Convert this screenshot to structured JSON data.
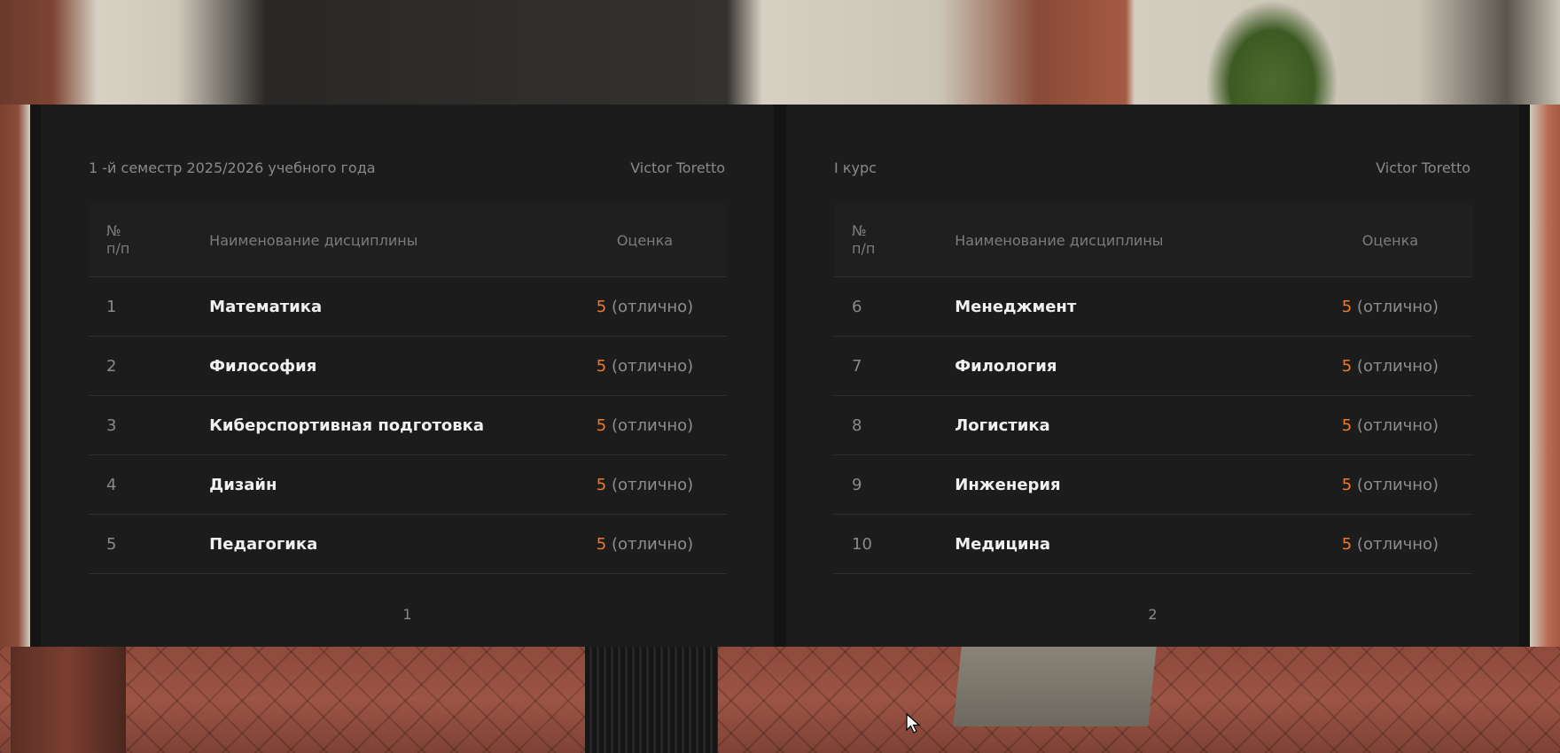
{
  "left_page": {
    "header_left": "1 -й семестр 2025/2026 учебного года",
    "header_right": "Victor Toretto",
    "columns": {
      "num": "№ п/п",
      "name": "Наименование дисциплины",
      "grade": "Оценка"
    },
    "rows": [
      {
        "num": "1",
        "name": "Математика",
        "grade": "5",
        "grade_text": "(отлично)"
      },
      {
        "num": "2",
        "name": "Философия",
        "grade": "5",
        "grade_text": "(отлично)"
      },
      {
        "num": "3",
        "name": "Киберспортивная подготовка",
        "grade": "5",
        "grade_text": "(отлично)"
      },
      {
        "num": "4",
        "name": "Дизайн",
        "grade": "5",
        "grade_text": "(отлично)"
      },
      {
        "num": "5",
        "name": "Педагогика",
        "grade": "5",
        "grade_text": "(отлично)"
      }
    ],
    "page_number": "1"
  },
  "right_page": {
    "header_left": "I курс",
    "header_right": "Victor Toretto",
    "columns": {
      "num": "№ п/п",
      "name": "Наименование дисциплины",
      "grade": "Оценка"
    },
    "rows": [
      {
        "num": "6",
        "name": "Менеджмент",
        "grade": "5",
        "grade_text": "(отлично)"
      },
      {
        "num": "7",
        "name": "Филология",
        "grade": "5",
        "grade_text": "(отлично)"
      },
      {
        "num": "8",
        "name": "Логистика",
        "grade": "5",
        "grade_text": "(отлично)"
      },
      {
        "num": "9",
        "name": "Инженерия",
        "grade": "5",
        "grade_text": "(отлично)"
      },
      {
        "num": "10",
        "name": "Медицина",
        "grade": "5",
        "grade_text": "(отлично)"
      }
    ],
    "page_number": "2"
  },
  "colors": {
    "panel_bg": "#1c1c1c",
    "grade_accent": "#f07a2a",
    "muted_text": "#8a8a8a",
    "primary_text": "#f0f0f0"
  }
}
